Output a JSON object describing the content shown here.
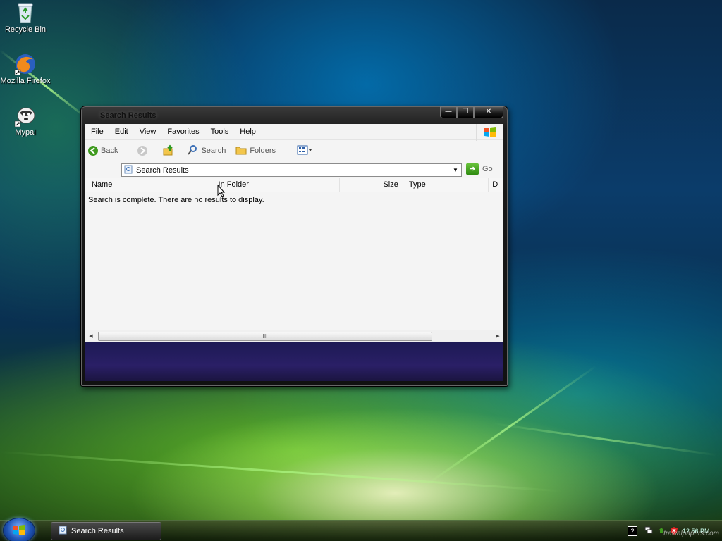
{
  "desktop": {
    "icons": [
      {
        "label": "Recycle Bin"
      },
      {
        "label": "Mozilla Firefox"
      },
      {
        "label": "Mypal"
      }
    ]
  },
  "window": {
    "title": "Search Results",
    "caption_buttons": {
      "minimize": "—",
      "maximize": "☐",
      "close": "✕"
    },
    "menu": [
      "File",
      "Edit",
      "View",
      "Favorites",
      "Tools",
      "Help"
    ],
    "toolbar": {
      "back": "Back",
      "search": "Search",
      "folders": "Folders"
    },
    "address": {
      "value": "Search Results",
      "go": "Go"
    },
    "columns": [
      "Name",
      "In Folder",
      "Size",
      "Type",
      "D"
    ],
    "empty_message": "Search is complete. There are no results to display.",
    "scroll_thumb": "III"
  },
  "taskbar": {
    "task_label": "Search Results",
    "clock": "12:56 PM",
    "watermark": "trawalpapers.com"
  },
  "colors": {
    "accent_green": "#3f9a1e",
    "window_frame": "#1a1a1a"
  }
}
